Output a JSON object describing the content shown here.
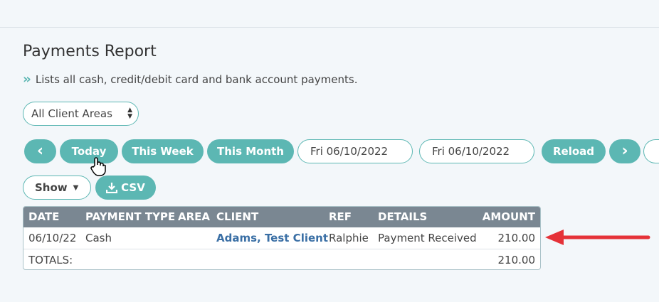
{
  "page": {
    "title": "Payments Report",
    "subtitle": "Lists all cash, credit/debit card and bank account payments."
  },
  "filters": {
    "area_select": "All Client Areas",
    "prev_label": "‹",
    "today_label": "Today",
    "this_week_label": "This Week",
    "this_month_label": "This Month",
    "start_date": "Fri 06/10/2022",
    "end_date": "Fri 06/10/2022",
    "reload_label": "Reload",
    "next_label": "›"
  },
  "actions": {
    "show_label": "Show",
    "csv_label": "CSV"
  },
  "table": {
    "headers": [
      "DATE",
      "PAYMENT TYPE",
      "AREA",
      "CLIENT",
      "REF",
      "DETAILS",
      "AMOUNT"
    ],
    "rows": [
      {
        "date": "06/10/22",
        "payment_type": "Cash",
        "area": "",
        "client": "Adams, Test Client",
        "ref": "Ralphie",
        "details": "Payment Received",
        "amount": "210.00"
      }
    ],
    "totals_label": "TOTALS:",
    "totals_amount": "210.00"
  },
  "colors": {
    "accent": "#5cb7b3",
    "header_bg": "#7a8792",
    "link": "#3a6fa5",
    "annotation_arrow": "#e53238"
  }
}
